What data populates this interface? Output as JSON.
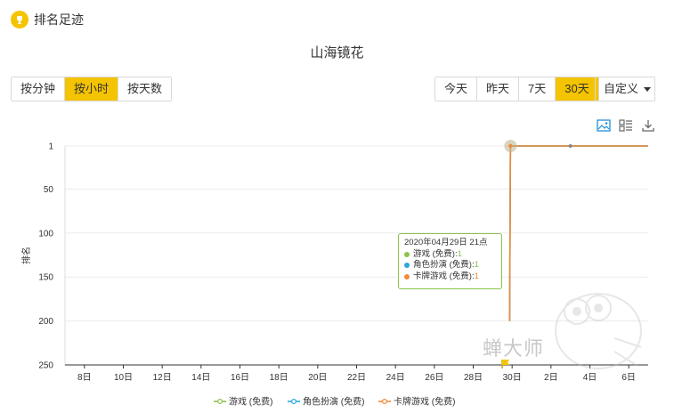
{
  "header": {
    "title": "排名足迹"
  },
  "chart_title": "山海镜花",
  "granularity_buttons": [
    {
      "label": "按分钟",
      "active": false
    },
    {
      "label": "按小时",
      "active": true
    },
    {
      "label": "按天数",
      "active": false
    }
  ],
  "range_buttons": [
    {
      "label": "今天",
      "active": false
    },
    {
      "label": "昨天",
      "active": false
    },
    {
      "label": "7天",
      "active": false
    },
    {
      "label": "30天",
      "active": true
    }
  ],
  "custom_dropdown": {
    "label": "自定义"
  },
  "toolbar": {
    "icons": [
      "image-icon",
      "data-view-icon",
      "download-icon"
    ]
  },
  "tooltip": {
    "time": "2020年04月29日 21点",
    "rows": [
      {
        "label": "游戏 (免费)",
        "sep": ": ",
        "value": "1",
        "color": "#8bc34a"
      },
      {
        "label": "角色扮演 (免费)",
        "sep": ": ",
        "value": "1",
        "color": "#29a8e0"
      },
      {
        "label": "卡牌游戏 (免费)",
        "sep": ": ",
        "value": "1",
        "color": "#f08a3a"
      }
    ]
  },
  "watermark": "蝉大师",
  "chart_data": {
    "type": "line",
    "ylabel": "排名",
    "y_inverted": true,
    "ylim": [
      1,
      250
    ],
    "yticks": [
      1,
      50,
      100,
      150,
      200,
      250
    ],
    "xticks": [
      "8日",
      "10日",
      "12日",
      "14日",
      "16日",
      "18日",
      "20日",
      "22日",
      "24日",
      "26日",
      "28日",
      "30日",
      "2日",
      "4日",
      "6日"
    ],
    "xrange": [
      "2020-04-07",
      "2020-05-07"
    ],
    "grid": true,
    "legend_position": "bottom",
    "series": [
      {
        "name": "游戏 (免费)",
        "color": "#8bc34a",
        "points": [
          [
            "2020-04-29 21:00",
            200
          ],
          [
            "2020-04-29 22:00",
            1
          ],
          [
            "2020-05-07 00:00",
            1
          ]
        ]
      },
      {
        "name": "角色扮演 (免费)",
        "color": "#29a8e0",
        "points": [
          [
            "2020-04-29 21:00",
            200
          ],
          [
            "2020-04-29 22:00",
            1
          ],
          [
            "2020-05-07 00:00",
            1
          ]
        ]
      },
      {
        "name": "卡牌游戏 (免费)",
        "color": "#f08a3a",
        "points": [
          [
            "2020-04-29 21:00",
            200
          ],
          [
            "2020-04-29 22:00",
            1
          ],
          [
            "2020-05-07 00:00",
            1
          ]
        ]
      }
    ]
  }
}
